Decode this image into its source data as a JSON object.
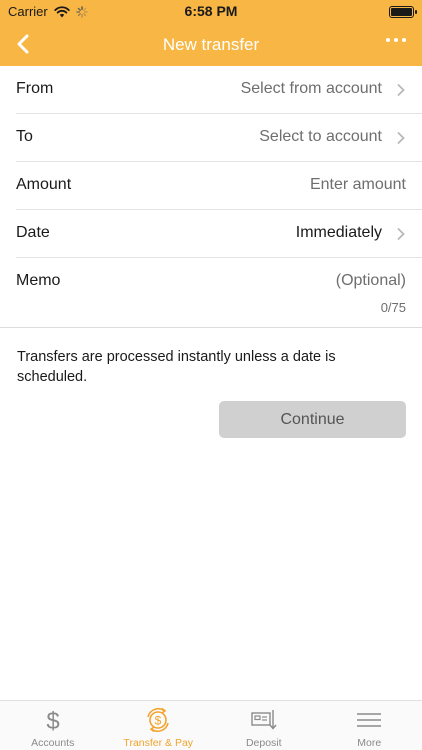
{
  "status_bar": {
    "carrier": "Carrier",
    "time": "6:58 PM"
  },
  "nav": {
    "title": "New transfer"
  },
  "form": {
    "from": {
      "label": "From",
      "value": "Select from account"
    },
    "to": {
      "label": "To",
      "value": "Select to account"
    },
    "amount": {
      "label": "Amount",
      "placeholder": "Enter amount"
    },
    "date": {
      "label": "Date",
      "value": "Immediately"
    },
    "memo": {
      "label": "Memo",
      "placeholder": "(Optional)",
      "counter": "0/75"
    }
  },
  "info_text": "Transfers are processed instantly unless a date is scheduled.",
  "continue_label": "Continue",
  "tabs": [
    {
      "label": "Accounts",
      "icon": "dollar-icon",
      "active": false
    },
    {
      "label": "Transfer & Pay",
      "icon": "transfer-pay-icon",
      "active": true
    },
    {
      "label": "Deposit",
      "icon": "check-deposit-icon",
      "active": false
    },
    {
      "label": "More",
      "icon": "menu-icon",
      "active": false
    }
  ],
  "colors": {
    "accent": "#f8b645",
    "active_tab": "#f2a42f",
    "button_disabled": "#d0d0d0"
  }
}
